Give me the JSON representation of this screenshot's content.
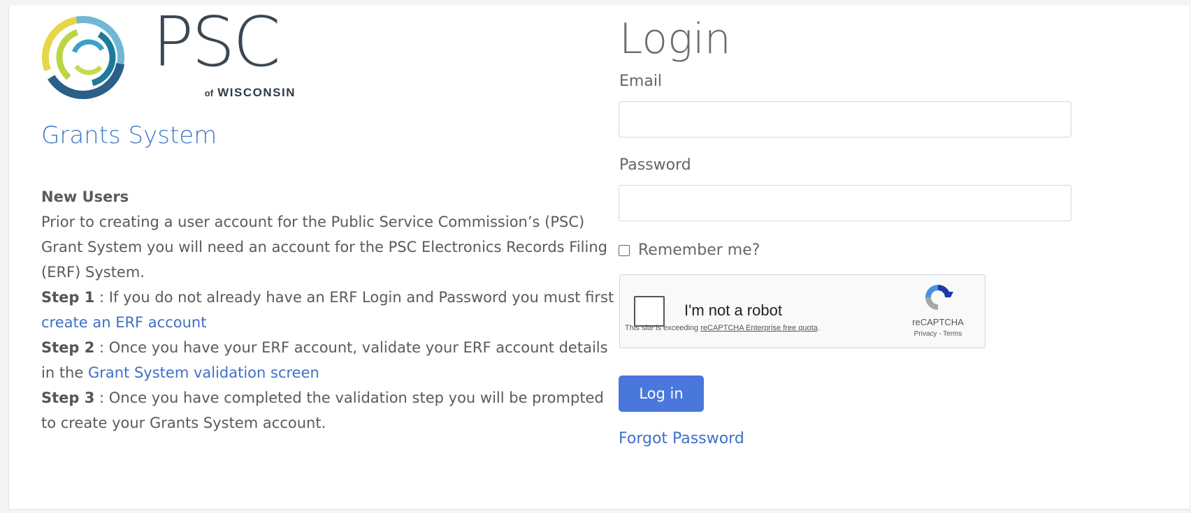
{
  "brand": {
    "logo_name": "PSC",
    "logo_sub_of": "of",
    "logo_sub_state": "WISCONSIN",
    "app_title": "Grants System"
  },
  "info": {
    "heading": "New Users",
    "intro": "Prior to creating a user account for the Public Service Commission’s (PSC) Grant System you will need an account for the PSC Electronics Records Filing (ERF) System.",
    "step1_label": "Step 1",
    "step1_text": " : If you do not already have an ERF Login and Password you must first ",
    "step1_link": "create an ERF account",
    "step2_label": "Step 2",
    "step2_text": " : Once you have your ERF account, validate your ERF account details in the ",
    "step2_link": "Grant System validation screen",
    "step3_label": "Step 3",
    "step3_text": " : Once you have completed the validation step you will be prompted to create your Grants System account."
  },
  "login": {
    "title": "Login",
    "email_label": "Email",
    "email_value": "",
    "password_label": "Password",
    "password_value": "",
    "remember_label": "Remember me?",
    "remember_checked": false,
    "submit_label": "Log in",
    "forgot_label": "Forgot Password"
  },
  "captcha": {
    "label": "I'm not a robot",
    "warning_prefix": "This site is exceeding ",
    "warning_link": "reCAPTCHA Enterprise free quota",
    "warning_suffix": ".",
    "brand": "reCAPTCHA",
    "privacy": "Privacy",
    "separator": " - ",
    "terms": "Terms"
  },
  "colors": {
    "link": "#3f6fc8",
    "button": "#4a77db",
    "title_blue": "#3f7ac4"
  }
}
